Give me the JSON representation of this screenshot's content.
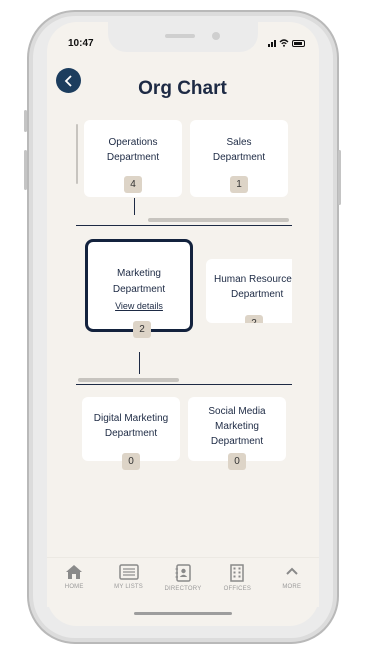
{
  "status": {
    "time": "10:47"
  },
  "header": {
    "title": "Org Chart"
  },
  "row1": [
    {
      "name": "Operations Department",
      "line1": "Operations",
      "line2": "Department",
      "count": "4"
    },
    {
      "name": "Sales Department",
      "line1": "Sales",
      "line2": "Department",
      "count": "1"
    }
  ],
  "row2": [
    {
      "line1": "Marketing",
      "line2": "Department",
      "link": "View details",
      "count": "2",
      "selected": true
    },
    {
      "line1": "Human Resources",
      "line2": "Department",
      "count": "2"
    }
  ],
  "row3": [
    {
      "line1": "Digital Marketing",
      "line2": "Department",
      "count": "0"
    },
    {
      "line1": "Social Media",
      "line2": "Marketing",
      "line3": "Department",
      "count": "0"
    }
  ],
  "tabs": [
    {
      "label": "HOME",
      "icon": "home-icon"
    },
    {
      "label": "MY LISTS",
      "icon": "list-icon"
    },
    {
      "label": "DIRECTORY",
      "icon": "directory-icon"
    },
    {
      "label": "OFFICES",
      "icon": "building-icon"
    },
    {
      "label": "MORE",
      "icon": "chevron-up-icon"
    }
  ],
  "colors": {
    "accent": "#1c3d5e",
    "background": "#f5f2ed",
    "badge": "#ddd4c7"
  }
}
